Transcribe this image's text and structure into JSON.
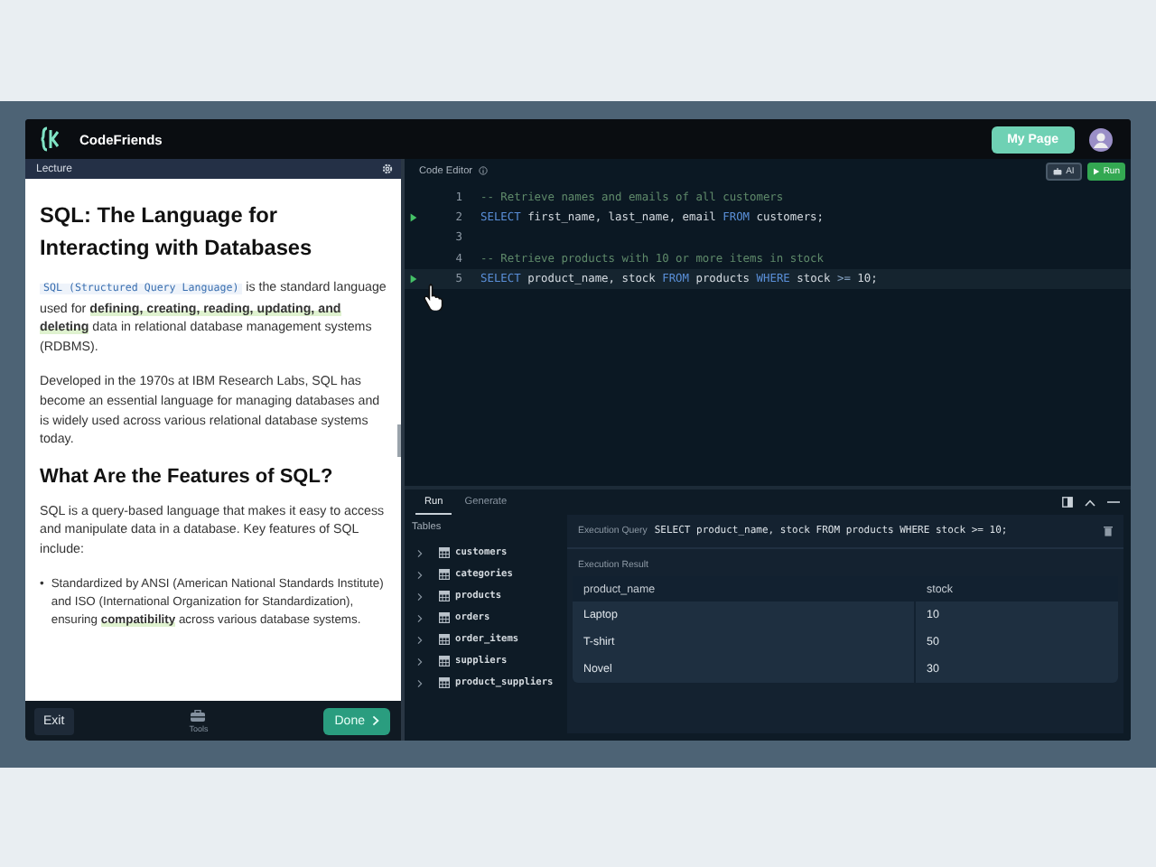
{
  "app": {
    "name": "CodeFriends",
    "my_page_button": "My Page"
  },
  "lecture": {
    "header": "Lecture",
    "title": "SQL: The Language for Interacting with Databases",
    "blocks": [
      {
        "kind": "paragraph",
        "segments": [
          {
            "kind": "code",
            "text": "SQL (Structured Query Language)"
          },
          {
            "kind": "text",
            "text": " is the standard language used for "
          },
          {
            "kind": "highlight",
            "text": "defining, creating, reading, updating, and deleting"
          },
          {
            "kind": "text",
            "text": " data in relational database management systems (RDBMS)."
          }
        ]
      },
      {
        "kind": "paragraph",
        "segments": [
          {
            "kind": "text",
            "text": "Developed in the 1970s at IBM Research Labs, SQL has become an essential language for managing databases and is widely used across various relational database systems today."
          }
        ]
      },
      {
        "kind": "heading",
        "segments": [
          {
            "kind": "text",
            "text": "What Are the Features of SQL?"
          }
        ]
      },
      {
        "kind": "paragraph",
        "segments": [
          {
            "kind": "text",
            "text": "SQL is a query-based language that makes it easy to access and manipulate data in a database. Key features of SQL include:"
          }
        ]
      },
      {
        "kind": "bullet",
        "marker": "•",
        "segments": [
          {
            "kind": "text",
            "text": "Standardized by ANSI (American National Standards Institute) and ISO (International Organization for Standardization), ensuring "
          },
          {
            "kind": "highlight",
            "text": "compatibility"
          },
          {
            "kind": "text",
            "text": " across various database systems."
          }
        ]
      }
    ],
    "footer": {
      "exit": "Exit",
      "tools": "Tools",
      "done": "Done"
    }
  },
  "editor": {
    "title": "Code Editor",
    "ai_button": "AI",
    "run_button": "Run",
    "lines": [
      {
        "number": "1",
        "runnable": false,
        "selected": false,
        "tokens": [
          {
            "kind": "comment",
            "text": "-- Retrieve names and emails of all customers"
          }
        ]
      },
      {
        "number": "2",
        "runnable": true,
        "selected": false,
        "tokens": [
          {
            "kind": "keyword",
            "text": "SELECT"
          },
          {
            "kind": "plain",
            "text": " first_name, last_name, email "
          },
          {
            "kind": "keyword",
            "text": "FROM"
          },
          {
            "kind": "plain",
            "text": " customers;"
          }
        ]
      },
      {
        "number": "3",
        "runnable": false,
        "selected": false
      },
      {
        "number": "4",
        "runnable": false,
        "selected": false,
        "tokens": [
          {
            "kind": "comment",
            "text": "-- Retrieve products with 10 or more items in stock"
          }
        ]
      },
      {
        "number": "5",
        "runnable": true,
        "selected": true,
        "tokens": [
          {
            "kind": "keyword",
            "text": "SELECT"
          },
          {
            "kind": "plain",
            "text": " product_name, stock "
          },
          {
            "kind": "keyword",
            "text": "FROM"
          },
          {
            "kind": "plain",
            "text": " products "
          },
          {
            "kind": "keyword",
            "text": "WHERE"
          },
          {
            "kind": "plain",
            "text": " stock "
          },
          {
            "kind": "operator",
            "text": ">="
          },
          {
            "kind": "plain",
            "text": " 10;"
          }
        ]
      }
    ]
  },
  "console": {
    "tabs": [
      {
        "label": "Run",
        "selected": true
      },
      {
        "label": "Generate",
        "selected": false
      }
    ],
    "tables_label": "Tables",
    "tables": [
      "customers",
      "categories",
      "products",
      "orders",
      "order_items",
      "suppliers",
      "product_suppliers"
    ],
    "query_label": "Execution Query",
    "query": "SELECT product_name, stock FROM products WHERE stock >= 10;",
    "result_label": "Execution Result",
    "result": {
      "columns": [
        "product_name",
        "stock"
      ],
      "rows": [
        [
          "Laptop",
          "10"
        ],
        [
          "T-shirt",
          "50"
        ],
        [
          "Novel",
          "30"
        ]
      ]
    }
  }
}
